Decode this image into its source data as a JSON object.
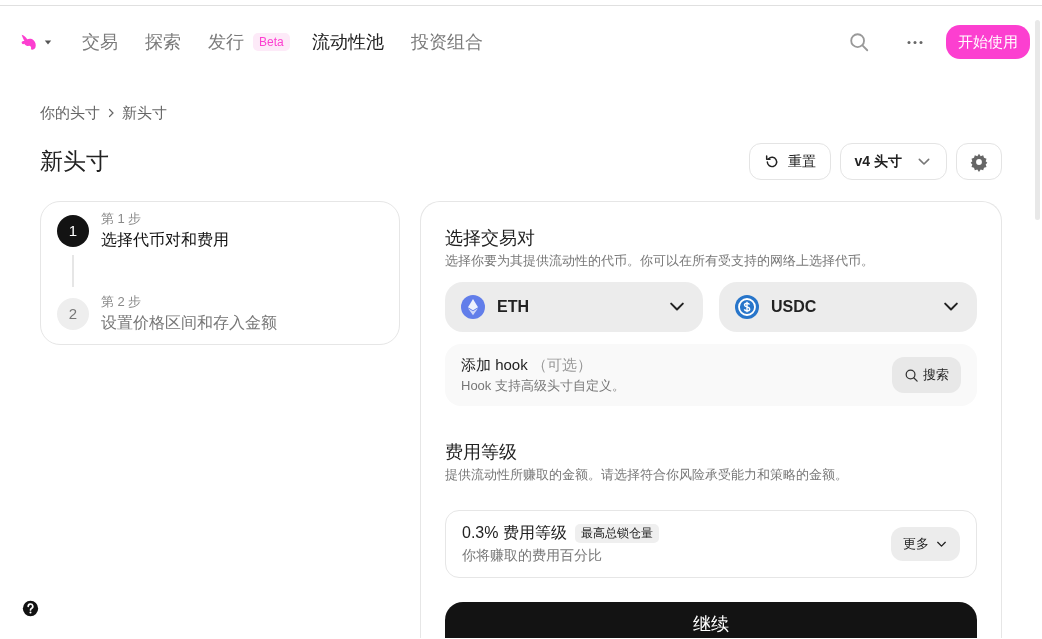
{
  "nav": {
    "items": [
      {
        "label": "交易",
        "selected": false
      },
      {
        "label": "探索",
        "selected": false
      },
      {
        "label": "发行",
        "selected": false,
        "badge": "Beta"
      },
      {
        "label": "流动性池",
        "selected": true
      },
      {
        "label": "投资组合",
        "selected": false
      }
    ],
    "cta": "开始使用"
  },
  "breadcrumb": [
    "你的头寸",
    "新头寸"
  ],
  "page_title": "新头寸",
  "actions": {
    "reset": "重置",
    "version": "v4 头寸"
  },
  "steps": [
    {
      "number": "1",
      "label": "第 1 步",
      "title": "选择代币对和费用",
      "selected": true
    },
    {
      "number": "2",
      "label": "第 2 步",
      "title": "设置价格区间和存入金额",
      "selected": false
    }
  ],
  "pair": {
    "title": "选择交易对",
    "description": "选择你要为其提供流动性的代币。你可以在所有受支持的网络上选择代币。",
    "tokens": [
      {
        "symbol": "ETH",
        "kind": "eth"
      },
      {
        "symbol": "USDC",
        "kind": "usdc"
      }
    ]
  },
  "hook": {
    "title": "添加 hook",
    "optional": "（可选）",
    "description": "Hook 支持高级头寸自定义。",
    "button": "搜索"
  },
  "fee": {
    "title": "费用等级",
    "description": "提供流动性所赚取的金额。请选择符合你风险承受能力和策略的金额。",
    "tier": "0.3% 费用等级",
    "tag": "最高总锁仓量",
    "note": "你将赚取的费用百分比",
    "more": "更多"
  },
  "continue": "继续"
}
